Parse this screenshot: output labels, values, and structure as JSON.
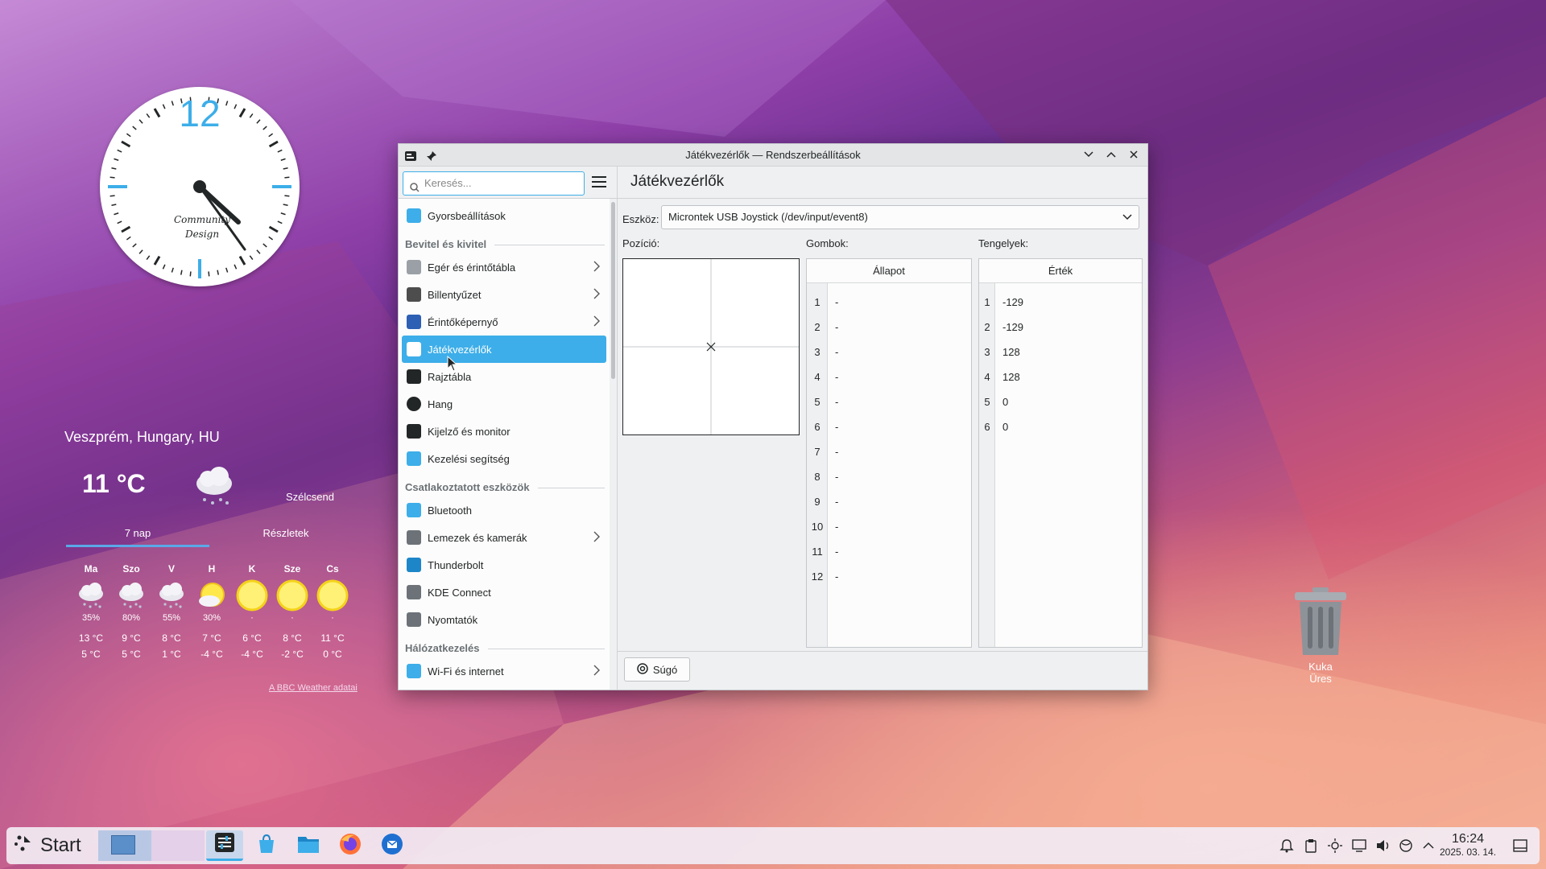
{
  "window": {
    "title": "Játékvezérlők — Rendszerbeállítások",
    "page_title": "Játékvezérlők"
  },
  "search": {
    "placeholder": "Keresés..."
  },
  "sidebar": {
    "quick": "Gyorsbeállítások",
    "sections": [
      {
        "heading": "Bevitel és kivitel",
        "items": [
          {
            "label": "Egér és érintőtábla",
            "chevron": true
          },
          {
            "label": "Billentyűzet",
            "chevron": true
          },
          {
            "label": "Érintőképernyő",
            "chevron": true
          },
          {
            "label": "Játékvezérlők",
            "selected": true
          },
          {
            "label": "Rajztábla"
          },
          {
            "label": "Hang"
          },
          {
            "label": "Kijelző és monitor"
          },
          {
            "label": "Kezelési segítség"
          }
        ]
      },
      {
        "heading": "Csatlakoztatott eszközök",
        "items": [
          {
            "label": "Bluetooth"
          },
          {
            "label": "Lemezek és kamerák",
            "chevron": true
          },
          {
            "label": "Thunderbolt"
          },
          {
            "label": "KDE Connect"
          },
          {
            "label": "Nyomtatók"
          }
        ]
      },
      {
        "heading": "Hálózatkezelés",
        "items": [
          {
            "label": "Wi-Fi és internet",
            "chevron": true
          }
        ]
      }
    ]
  },
  "content": {
    "device_label": "Eszköz:",
    "device_value": "Microntek USB Joystick (/dev/input/event8)",
    "position_label": "Pozíció:",
    "buttons_label": "Gombok:",
    "axes_label": "Tengelyek:",
    "buttons_header": "Állapot",
    "axes_header": "Érték",
    "buttons": [
      {
        "n": "1",
        "v": "-"
      },
      {
        "n": "2",
        "v": "-"
      },
      {
        "n": "3",
        "v": "-"
      },
      {
        "n": "4",
        "v": "-"
      },
      {
        "n": "5",
        "v": "-"
      },
      {
        "n": "6",
        "v": "-"
      },
      {
        "n": "7",
        "v": "-"
      },
      {
        "n": "8",
        "v": "-"
      },
      {
        "n": "9",
        "v": "-"
      },
      {
        "n": "10",
        "v": "-"
      },
      {
        "n": "11",
        "v": "-"
      },
      {
        "n": "12",
        "v": "-"
      }
    ],
    "axes": [
      {
        "n": "1",
        "v": "-129"
      },
      {
        "n": "2",
        "v": "-129"
      },
      {
        "n": "3",
        "v": "128"
      },
      {
        "n": "4",
        "v": "128"
      },
      {
        "n": "5",
        "v": "0"
      },
      {
        "n": "6",
        "v": "0"
      }
    ],
    "help_button": "Súgó"
  },
  "clock_widget": {
    "numeral": "12",
    "brand_line1": "Community",
    "brand_line2": "Design"
  },
  "weather": {
    "location": "Veszprém, Hungary, HU",
    "temperature": "11 °C",
    "wind": "Szélcsend",
    "tab_days": "7 nap",
    "tab_details": "Részletek",
    "days": [
      {
        "name": "Ma",
        "icon": "rain-cloud-icon",
        "precip": "35%",
        "high": "13 °C",
        "low": "5 °C"
      },
      {
        "name": "Szo",
        "icon": "rain-cloud-icon",
        "precip": "80%",
        "high": "9 °C",
        "low": "5 °C"
      },
      {
        "name": "V",
        "icon": "rain-cloud-icon",
        "precip": "55%",
        "high": "8 °C",
        "low": "1 °C"
      },
      {
        "name": "H",
        "icon": "partly-cloudy-icon",
        "precip": "30%",
        "high": "7 °C",
        "low": "-4 °C"
      },
      {
        "name": "K",
        "icon": "sun-icon",
        "precip": "·",
        "high": "6 °C",
        "low": "-4 °C"
      },
      {
        "name": "Sze",
        "icon": "sun-icon",
        "precip": "·",
        "high": "8 °C",
        "low": "-2 °C"
      },
      {
        "name": "Cs",
        "icon": "sun-icon",
        "precip": "·",
        "high": "11 °C",
        "low": "0 °C"
      }
    ],
    "credit": "A BBC Weather adatai"
  },
  "trash": {
    "label": "Kuka",
    "status": "Üres"
  },
  "taskbar": {
    "start": "Start",
    "time": "16:24",
    "date": "2025. 03. 14."
  }
}
